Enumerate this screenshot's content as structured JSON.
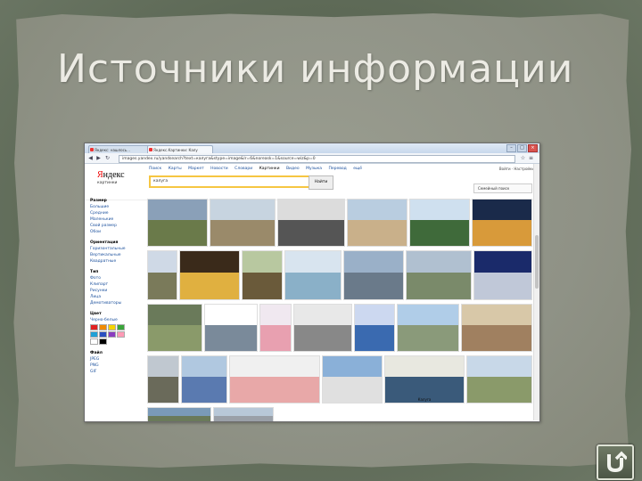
{
  "slide": {
    "title": "Источники информации"
  },
  "browser": {
    "tabs": [
      {
        "label": "Яндекс: нашлось...",
        "active": false
      },
      {
        "label": "Яндекс.Картинки: Калу",
        "active": true
      }
    ],
    "url": "images.yandex.ru/yandsearch?text=калуга&stype=image&lr=6&noreask=1&source=wiz&p=0",
    "window_buttons": [
      "–",
      "□",
      "×"
    ]
  },
  "yandex": {
    "logo_y": "Я",
    "logo_rest": "ндекс",
    "subtitle": "картинки",
    "topnav": [
      "Поиск",
      "Карты",
      "Маркет",
      "Новости",
      "Словари",
      "Картинки",
      "Видео",
      "Музыка",
      "Перевод",
      "ещё"
    ],
    "active_nav": "Картинки",
    "search_value": "калуга",
    "search_button": "Найти",
    "user": "Войти · Настройки",
    "settings_link": "Семейный поиск"
  },
  "sidebar": {
    "groups": [
      {
        "head": "Размер",
        "items": [
          "Большие",
          "Средние",
          "Маленькие",
          "Свой размер",
          "Обои"
        ]
      },
      {
        "head": "Ориентация",
        "items": [
          "Горизонтальные",
          "Вертикальные",
          "Квадратные"
        ]
      },
      {
        "head": "Тип",
        "items": [
          "Фото",
          "Клипарт",
          "Рисунки",
          "Лица",
          "Демотиваторы"
        ]
      },
      {
        "head": "Цвет",
        "items": [
          "Черно-белые"
        ]
      },
      {
        "head": "Файл",
        "items": [
          "JPEG",
          "PNG",
          "GIF"
        ]
      }
    ],
    "swatch_colors": [
      "#e02020",
      "#f08a00",
      "#f5d400",
      "#3aa53a",
      "#1fa0d6",
      "#2a4fc0",
      "#8a3cc0",
      "#ff9ab5",
      "#ffffff",
      "#000000"
    ]
  },
  "images": [
    {
      "label": ""
    },
    {
      "label": ""
    },
    {
      "label": ""
    },
    {
      "label": ""
    },
    {
      "label": ""
    },
    {
      "label": ""
    },
    {
      "label": ""
    },
    {
      "label": ""
    },
    {
      "label": ""
    },
    {
      "label": ""
    },
    {
      "label": ""
    },
    {
      "label": ""
    },
    {
      "label": ""
    },
    {
      "label": ""
    },
    {
      "label": ""
    },
    {
      "label": ""
    },
    {
      "label": ""
    },
    {
      "label": ""
    },
    {
      "label": ""
    },
    {
      "label": ""
    },
    {
      "label": ""
    },
    {
      "label": ""
    },
    {
      "label": ""
    },
    {
      "label": ""
    },
    {
      "label": "Калуга"
    },
    {
      "label": ""
    },
    {
      "label": ""
    },
    {
      "label": ""
    }
  ],
  "nav_button": {
    "icon": "return-icon"
  }
}
